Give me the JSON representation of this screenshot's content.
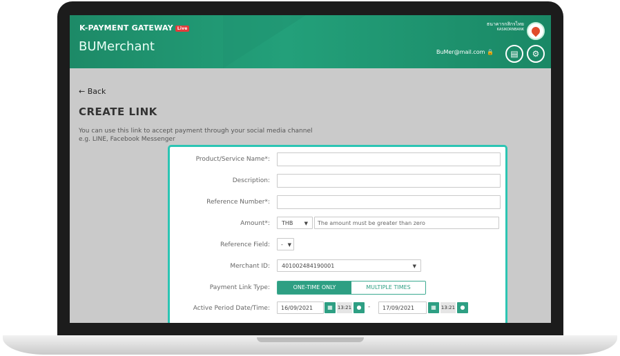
{
  "header": {
    "brand": "K-PAYMENT GATEWAY",
    "badge": "Live",
    "merchant_name": "BUMerchant",
    "bank_name_line1": "ธนาคารกสิกรไทย",
    "bank_name_line2": "KASIKORNBANK",
    "email": "BuMer@mail.com",
    "colors": {
      "header_green": "#1d8a67",
      "accent_teal": "#2bc5b3",
      "button_green": "#2e9f83"
    }
  },
  "page": {
    "back_label": "Back",
    "title": "CREATE LINK",
    "description_line1": "You can use this link to accept payment through your social media channel",
    "description_line2": "e.g. LINE, Facebook Messenger"
  },
  "form": {
    "product_label": "Product/Service Name*:",
    "product_value": "",
    "description_label": "Description:",
    "description_value": "",
    "reference_number_label": "Reference Number*:",
    "reference_number_value": "",
    "amount_label": "Amount*:",
    "currency": "THB",
    "amount_placeholder": "The amount must be greater than zero",
    "reference_field_label": "Reference Field:",
    "reference_field_value": "-",
    "merchant_id_label": "Merchant ID:",
    "merchant_id_value": "401002484190001",
    "payment_type_label": "Payment Link Type:",
    "payment_type_option1": "ONE-TIME ONLY",
    "payment_type_option2": "MULTIPLE TIMES",
    "active_period_label": "Active Period Date/Time:",
    "start_date": "16/09/2021",
    "start_time": "13:21",
    "end_date": "17/09/2021",
    "end_time": "13:21",
    "date_separator": "-"
  },
  "icons": [
    "arrow-left-icon",
    "lock-icon",
    "clipboard-icon",
    "gear-icon",
    "calendar-icon",
    "clock-icon",
    "chevron-down-icon"
  ]
}
